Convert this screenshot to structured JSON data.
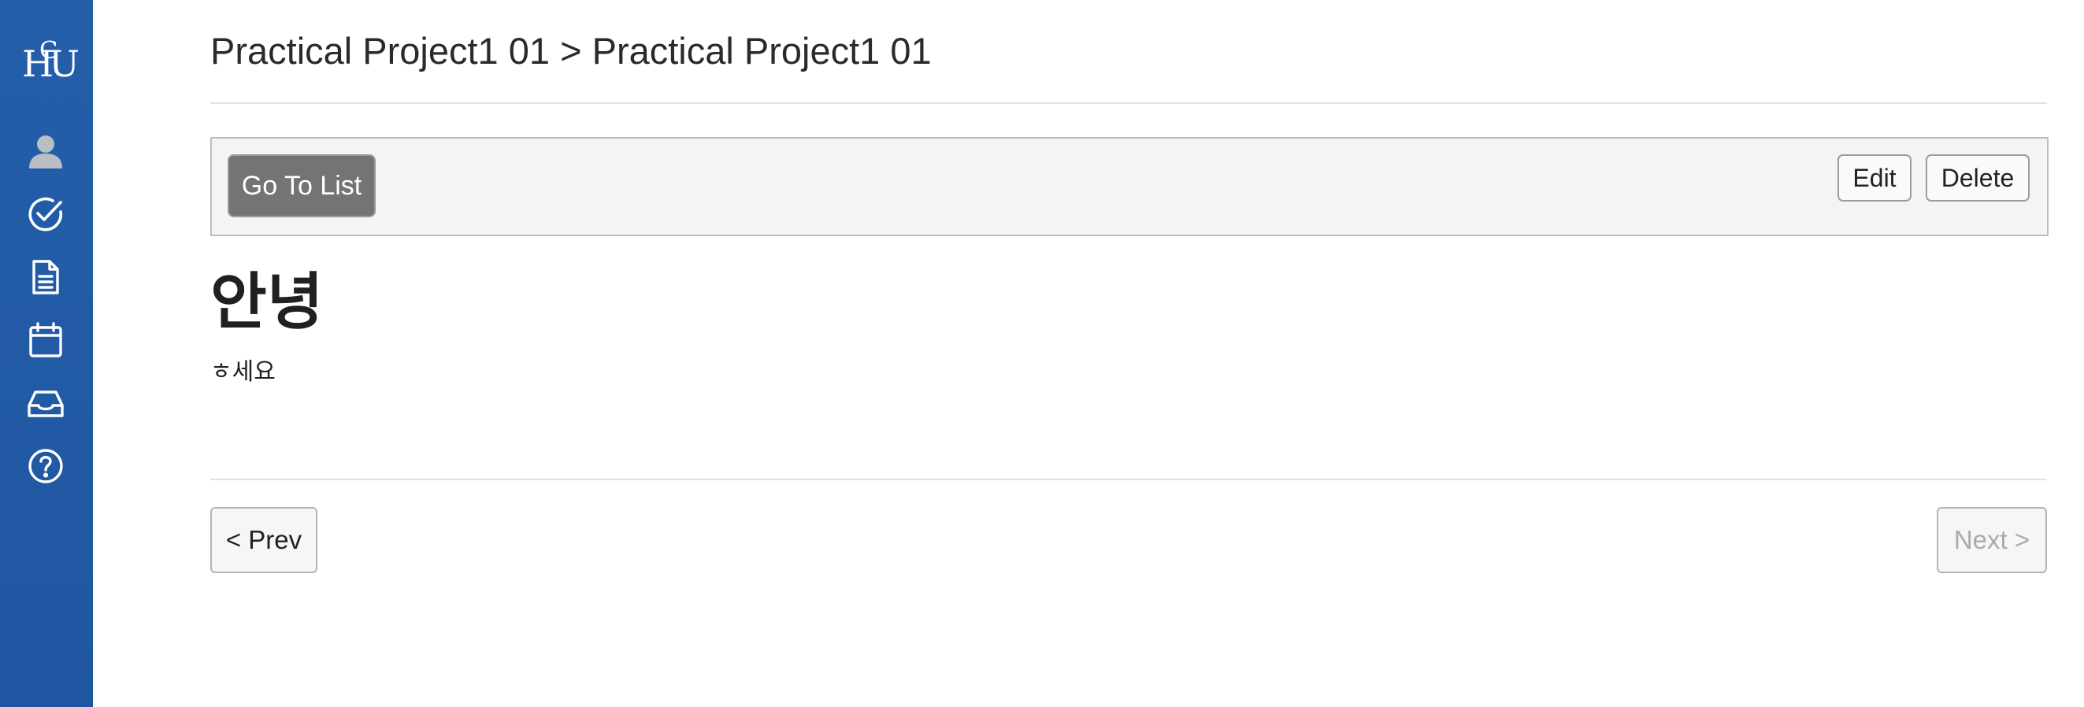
{
  "sidebar": {
    "logo_text": "HGU",
    "items": [
      {
        "icon": "user-icon"
      },
      {
        "icon": "check-circle-icon"
      },
      {
        "icon": "document-icon"
      },
      {
        "icon": "calendar-icon"
      },
      {
        "icon": "inbox-icon"
      },
      {
        "icon": "help-icon"
      }
    ],
    "color": "#2159a5"
  },
  "header": {
    "breadcrumb": "Practical Project1 01 > Practical Project1 01"
  },
  "toolbar": {
    "list_label": "Go To List",
    "edit_label": "Edit",
    "delete_label": "Delete"
  },
  "post": {
    "title": "안녕",
    "body": "ㅎ세요"
  },
  "pagination": {
    "prev_label": "< Prev",
    "next_label": "Next >",
    "next_disabled": true
  }
}
